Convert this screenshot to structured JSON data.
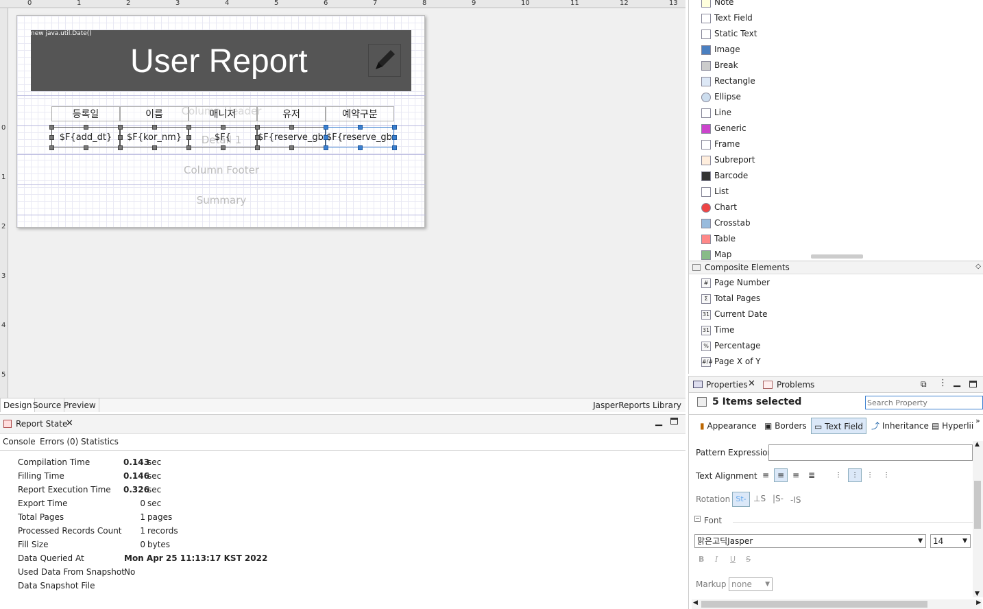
{
  "ruler": {
    "h": [
      "0",
      "1",
      "2",
      "3",
      "4",
      "5",
      "6",
      "7",
      "8",
      "9",
      "10",
      "11",
      "12",
      "13"
    ],
    "v": [
      "0",
      "1",
      "2",
      "3",
      "4",
      "5"
    ]
  },
  "report": {
    "date_expr": "new java.util.Date()",
    "title": "User Report",
    "headers": [
      "등록일",
      "이름",
      "매니저",
      "유저",
      "예약구분"
    ],
    "fields": [
      "$F{add_dt}",
      "$F{kor_nm}",
      "$F{",
      "$F{reserve_gbn}",
      "$F{reserve_gbn}"
    ],
    "bands": {
      "column_header": "Column Header",
      "detail": "Detail 1",
      "column_footer": "Column Footer",
      "summary": "Summary"
    }
  },
  "editor_tabs": [
    "Design",
    "Source",
    "Preview"
  ],
  "library_label": "JasperReports Library",
  "report_state": {
    "title": "Report State",
    "tabs": [
      "Console",
      "Errors (0)",
      "Statistics"
    ],
    "stats": [
      {
        "label": "Compilation Time",
        "value": "0.143",
        "unit": "sec"
      },
      {
        "label": "Filling Time",
        "value": "0.146",
        "unit": "sec"
      },
      {
        "label": "Report Execution Time",
        "value": "0.326",
        "unit": "sec"
      },
      {
        "label": "Export Time",
        "value": "0",
        "unit": "sec"
      },
      {
        "label": "Total Pages",
        "value": "1",
        "unit": "pages"
      },
      {
        "label": "Processed Records Count",
        "value": "1",
        "unit": "records"
      },
      {
        "label": "Fill Size",
        "value": "0",
        "unit": "bytes"
      },
      {
        "label": "Data Queried At",
        "value": "Mon Apr 25 11:13:17 KST 2022",
        "unit": ""
      },
      {
        "label": "Used Data From Snapshot",
        "value": "No",
        "unit": ""
      },
      {
        "label": "Data Snapshot File",
        "value": "",
        "unit": ""
      }
    ]
  },
  "palette": {
    "elements": [
      "Note",
      "Text Field",
      "Static Text",
      "Image",
      "Break",
      "Rectangle",
      "Ellipse",
      "Line",
      "Generic",
      "Frame",
      "Subreport",
      "Barcode",
      "List",
      "Chart",
      "Crosstab",
      "Table",
      "Map"
    ],
    "composite_title": "Composite Elements",
    "composite": [
      "Page Number",
      "Total Pages",
      "Current Date",
      "Time",
      "Percentage",
      "Page X of Y"
    ]
  },
  "properties": {
    "tabs": [
      "Properties",
      "Problems"
    ],
    "selection": "5 Items selected",
    "search_placeholder": "Search Property",
    "section_tabs": [
      "Appearance",
      "Borders",
      "Text Field",
      "Inheritance",
      "Hyperlii"
    ],
    "pattern_label": "Pattern Expression",
    "align_label": "Text Alignment",
    "rotation_label": "Rotation",
    "font_section": "Font",
    "font_name": "맑은고딕Jasper",
    "font_size": "14",
    "markup_label": "Markup",
    "markup_value": "none"
  },
  "colors": {
    "title_bg": "#555555",
    "selection": "#3a7fd0"
  }
}
